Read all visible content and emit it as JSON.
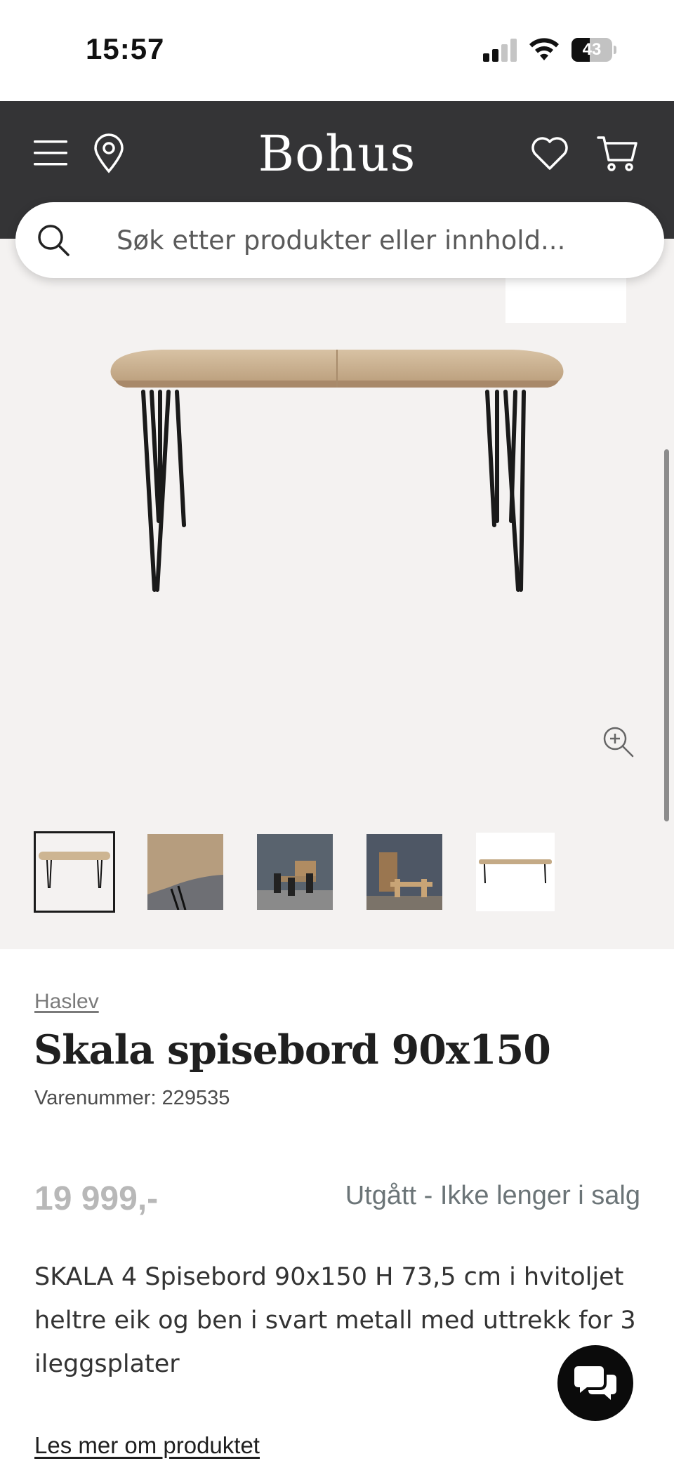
{
  "status_bar": {
    "time": "15:57",
    "battery_level": "43",
    "signal_bars_active": 2,
    "signal_bars_total": 4
  },
  "header": {
    "logo": "Bohus",
    "icons": [
      "menu-icon",
      "location-pin-icon",
      "heart-icon",
      "cart-icon"
    ],
    "background_color": "#343436"
  },
  "search": {
    "placeholder": "Søk etter produkter eller innhold..."
  },
  "gallery": {
    "background_color": "#f4f2f1",
    "thumbnail_count": 5,
    "selected_thumbnail": 1
  },
  "product": {
    "brand": "Haslev",
    "title": "Skala spisebord 90x150",
    "sku": "Varenummer: 229535",
    "price": "19 999,-",
    "availability": "Utgått - Ikke lenger i salg",
    "description": "SKALA 4 Spisebord 90x150 H 73,5 cm i hvitoljet heltre eik og ben i svart metall med uttrekk for 3 ileggsplater",
    "read_more": "Les mer om produktet"
  },
  "colors": {
    "header_bg": "#343436",
    "price_muted": "#b8b8b8",
    "availability": "#6b7477",
    "chat_button": "#0b0b0b"
  }
}
